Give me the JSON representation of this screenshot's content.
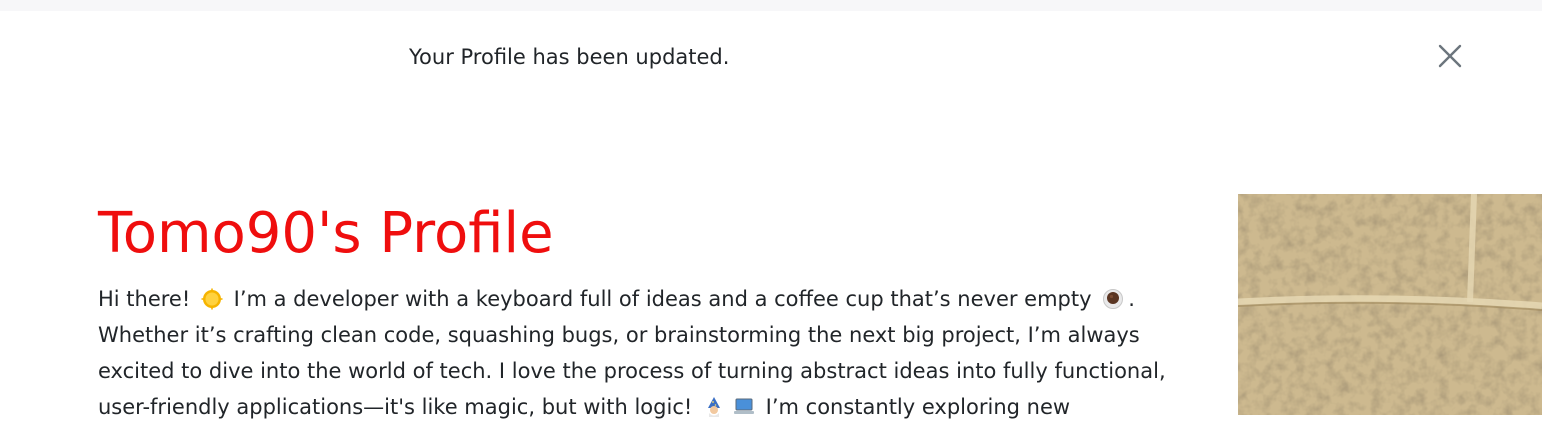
{
  "alert": {
    "message": "Your Profile has been updated."
  },
  "profile": {
    "title": "Tomo90's Profile",
    "bio_lines": [
      {
        "before": "Hi there! ",
        "emoji1": "sun-emoji",
        "middle": " I’m a developer with a keyboard full of ideas and a coffee cup that’s never empty ",
        "emoji2": "coffee-emoji",
        "after": "."
      },
      {
        "text": "Whether it’s crafting clean code, squashing bugs, or brainstorming the next big project, I’m always"
      },
      {
        "text": "excited to dive into the world of tech. I love the process of turning abstract ideas into fully functional,"
      },
      {
        "before": "user-friendly applications—it's like magic, but with logic! ",
        "emoji1": "wizard-emoji",
        "emoji2": "laptop-emoji",
        "after": " I’m constantly exploring new"
      }
    ]
  },
  "colors": {
    "title": "#ef0e0e",
    "text": "#212529",
    "top_strip": "#f7f7f9"
  }
}
